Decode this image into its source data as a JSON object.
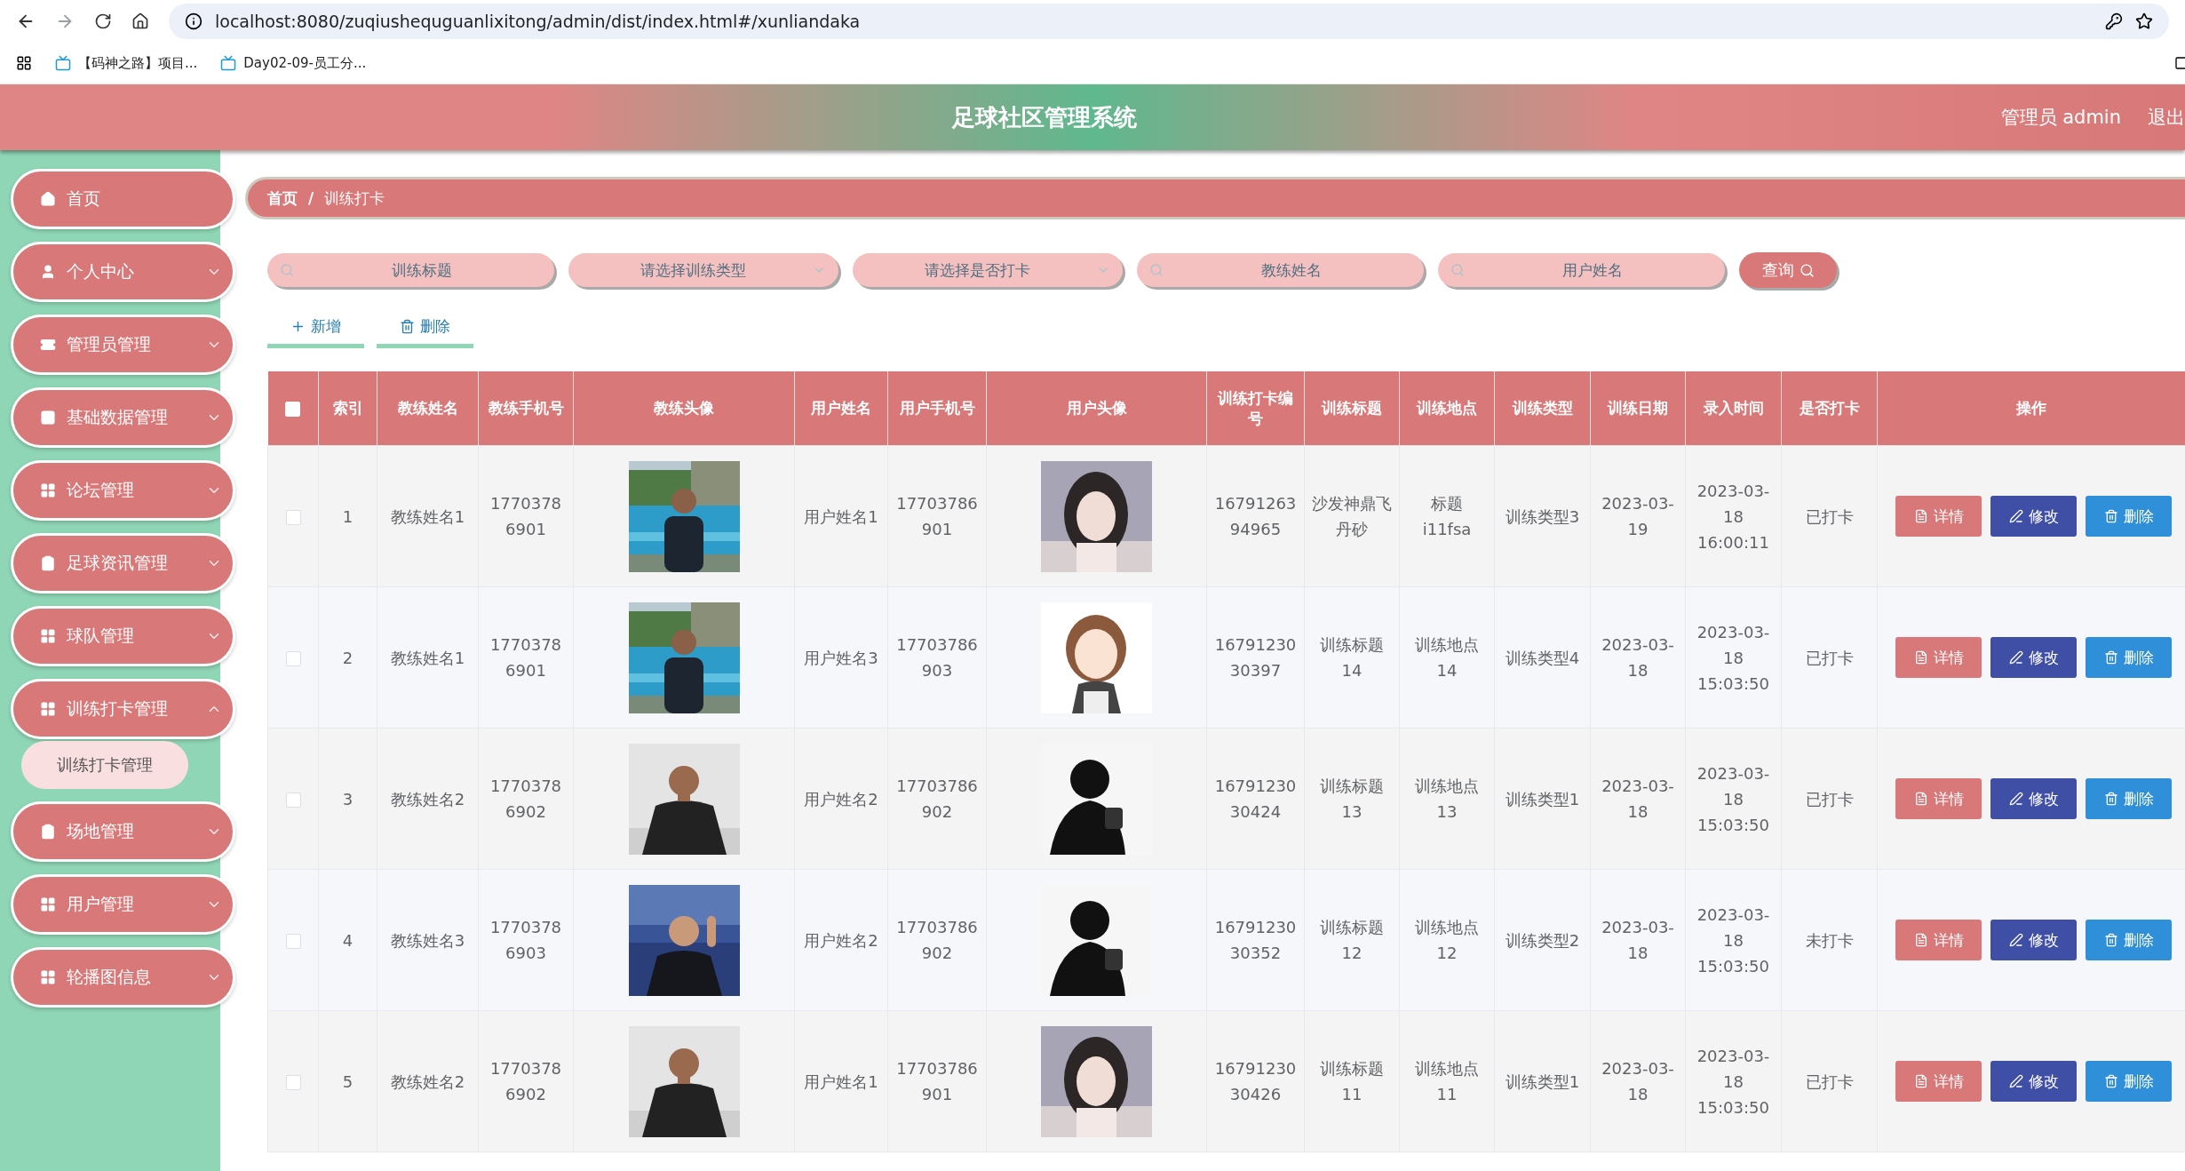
{
  "browser": {
    "url": "localhost:8080/zuqiushequguanlixitong/admin/dist/index.html#/xunliandaka",
    "bookmarks": [
      "【码神之路】项目...",
      "Day02-09-员工分..."
    ]
  },
  "header": {
    "title": "足球社区管理系统",
    "user": "管理员 admin",
    "logout": "退出"
  },
  "sidebar": {
    "items": [
      {
        "label": "首页",
        "kind": "link"
      },
      {
        "label": "个人中心",
        "kind": "menu",
        "expanded": false
      },
      {
        "label": "管理员管理",
        "kind": "menu",
        "expanded": false
      },
      {
        "label": "基础数据管理",
        "kind": "menu",
        "expanded": false
      },
      {
        "label": "论坛管理",
        "kind": "menu",
        "expanded": false
      },
      {
        "label": "足球资讯管理",
        "kind": "menu",
        "expanded": false
      },
      {
        "label": "球队管理",
        "kind": "menu",
        "expanded": false
      },
      {
        "label": "训练打卡管理",
        "kind": "menu",
        "expanded": true,
        "children": [
          {
            "label": "训练打卡管理",
            "selected": true
          }
        ]
      },
      {
        "label": "场地管理",
        "kind": "menu",
        "expanded": false
      },
      {
        "label": "用户管理",
        "kind": "menu",
        "expanded": false
      },
      {
        "label": "轮播图信息",
        "kind": "menu",
        "expanded": false
      }
    ]
  },
  "breadcrumb": {
    "items": [
      "首页",
      "训练打卡"
    ],
    "separator": "/"
  },
  "filters": [
    {
      "kind": "input",
      "placeholder": "训练标题"
    },
    {
      "kind": "select",
      "placeholder": "请选择训练类型"
    },
    {
      "kind": "select",
      "placeholder": "请选择是否打卡"
    },
    {
      "kind": "input",
      "placeholder": "教练姓名"
    },
    {
      "kind": "input",
      "placeholder": "用户姓名"
    }
  ],
  "search_button": "查询",
  "actions": [
    {
      "kind": "add",
      "label": "新增"
    },
    {
      "kind": "delete",
      "label": "删除"
    }
  ],
  "table": {
    "select_all": {
      "checked": false
    },
    "columns": [
      "索引",
      "教练姓名",
      "教练手机号",
      "教练头像",
      "用户姓名",
      "用户手机号",
      "用户头像",
      "训练打卡编号",
      "训练标题",
      "训练地点",
      "训练类型",
      "训练日期",
      "录入时间",
      "是否打卡",
      "操作"
    ],
    "rows": [
      {
        "checked": false,
        "index": "1",
        "coach_name": "教练姓名1",
        "coach_phone": "17703786901",
        "user_name": "用户姓名1",
        "user_phone": "17703786901",
        "number": "1679126394965",
        "title": "沙发神鼎飞丹砂",
        "location": "标题i11fsa",
        "type": "训练类型3",
        "date": "2023-03-19",
        "created": "2023-03-18 16:00:11",
        "status": "已打卡",
        "buttons": [
          "详情",
          "修改",
          "删除"
        ]
      },
      {
        "checked": false,
        "index": "2",
        "coach_name": "教练姓名1",
        "coach_phone": "17703786901",
        "user_name": "用户姓名3",
        "user_phone": "17703786903",
        "number": "1679123030397",
        "title": "训练标题14",
        "location": "训练地点14",
        "type": "训练类型4",
        "date": "2023-03-18",
        "created": "2023-03-18 15:03:50",
        "status": "已打卡",
        "buttons": [
          "详情",
          "修改",
          "删除"
        ]
      },
      {
        "checked": false,
        "index": "3",
        "coach_name": "教练姓名2",
        "coach_phone": "17703786902",
        "user_name": "用户姓名2",
        "user_phone": "17703786902",
        "number": "1679123030424",
        "title": "训练标题13",
        "location": "训练地点13",
        "type": "训练类型1",
        "date": "2023-03-18",
        "created": "2023-03-18 15:03:50",
        "status": "已打卡",
        "buttons": [
          "详情",
          "修改",
          "删除"
        ]
      },
      {
        "checked": false,
        "index": "4",
        "coach_name": "教练姓名3",
        "coach_phone": "17703786903",
        "user_name": "用户姓名2",
        "user_phone": "17703786902",
        "number": "1679123030352",
        "title": "训练标题12",
        "location": "训练地点12",
        "type": "训练类型2",
        "date": "2023-03-18",
        "created": "2023-03-18 15:03:50",
        "status": "未打卡",
        "buttons": [
          "详情",
          "修改",
          "删除"
        ]
      },
      {
        "checked": false,
        "index": "5",
        "coach_name": "教练姓名2",
        "coach_phone": "17703786902",
        "user_name": "用户姓名1",
        "user_phone": "17703786901",
        "number": "1679123030426",
        "title": "训练标题11",
        "location": "训练地点11",
        "type": "训练类型1",
        "date": "2023-03-18",
        "created": "2023-03-18 15:03:50",
        "status": "已打卡",
        "buttons": [
          "详情",
          "修改",
          "删除"
        ]
      }
    ]
  }
}
